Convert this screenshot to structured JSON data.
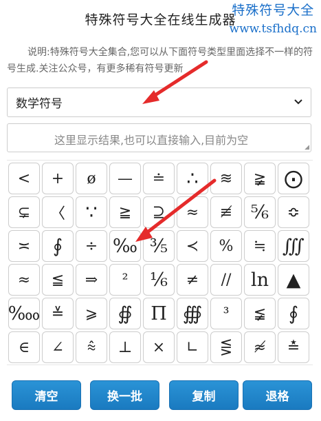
{
  "page": {
    "title": "特殊符号大全在线生成器"
  },
  "watermark": {
    "line1": "特殊符号大全",
    "line2": "www.tsfhdq.cn"
  },
  "description": "说明:特殊符号大全集合,您可以从下面符号类型里面选择不一样的符号生成.关注公众号，有更多稀有符号更新",
  "category_select": {
    "selected": "数学符号",
    "chevron": "chevron-down-icon"
  },
  "result_box": {
    "placeholder": "这里显示结果,也可以直接输入,目前为空",
    "value": ""
  },
  "symbols": [
    [
      "<",
      "+",
      "ø",
      "—",
      "≐",
      "∴",
      "≋",
      "≩",
      "⨀"
    ],
    [
      "⊊",
      "〈",
      "∵",
      "≧",
      "⊇",
      "≈",
      "≢",
      "⅚",
      "≎"
    ],
    [
      "≍",
      "∮",
      "÷",
      "‰",
      "⅗",
      "≺",
      "%",
      "≒",
      "∭"
    ],
    [
      "≈",
      "≦",
      "⇒",
      "²",
      "⅙",
      "≠",
      "//",
      "ln",
      "▲"
    ],
    [
      "‱",
      "≚",
      "⩾",
      "∯",
      "Π",
      "∰",
      "³",
      "≨",
      "∮"
    ],
    [
      "∈",
      "∠",
      "⩯",
      "⊥",
      "×",
      "∟",
      "⋚",
      "≉",
      "≛"
    ]
  ],
  "buttons": {
    "clear": "清空",
    "next_batch": "换一批",
    "copy": "复制",
    "backspace": "退格"
  },
  "annotation_color": "#e52b2b"
}
